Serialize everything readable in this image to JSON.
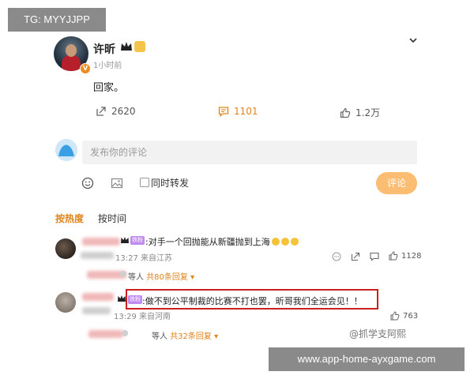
{
  "watermarks": {
    "top_left": "TG: MYYJJPP",
    "bottom_right": "www.app-home-ayxgame.com",
    "corner": "@抓学支阿熙"
  },
  "post": {
    "author": "许昕",
    "time": "1小时前",
    "text": "回家。",
    "stats": {
      "shares": "2620",
      "comments": "1101",
      "likes": "1.2万"
    }
  },
  "composer": {
    "placeholder": "发布你的评论",
    "repost_label": "同时转发",
    "post_button": "评论"
  },
  "sort": {
    "hot": "按热度",
    "time": "按时间"
  },
  "comments": [
    {
      "tag": "铁粉2",
      "text": ":对手一个回抛能从新疆抛到上海",
      "time": "13:27 来自江苏",
      "reply_prefix": "等人",
      "reply_link": "共80条回复",
      "likes": "1128"
    },
    {
      "tag": "铁粉4",
      "text": ":做不到公平制裁的比赛不打也罢，昕哥我们全运会见！！",
      "time": "13:29 来自河南",
      "reply_prefix": "等人",
      "reply_link": "共32条回复",
      "likes": "763"
    }
  ],
  "colors": {
    "accent": "#e0831b",
    "highlight": "#cc1f1f",
    "button": "#fbbd72"
  }
}
